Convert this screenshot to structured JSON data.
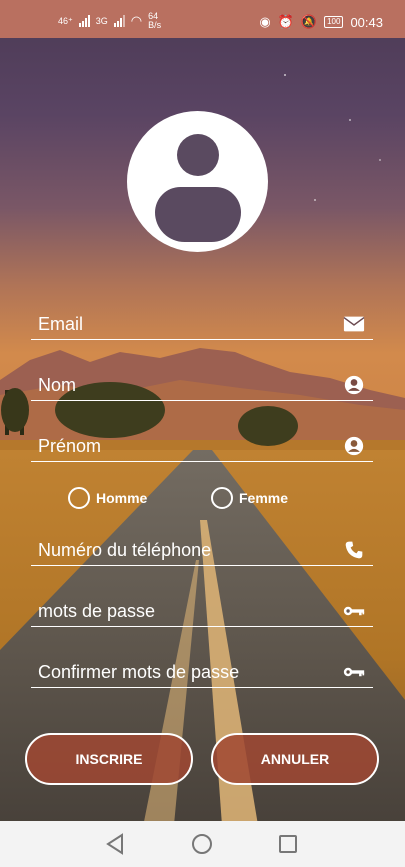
{
  "status_bar": {
    "network_label": "46⁺",
    "network2_label": "3G",
    "speed_label": "64\nB/s",
    "battery_label": "100",
    "time": "00:43"
  },
  "form": {
    "email_label": "Email",
    "nom_label": "Nom",
    "prenom_label": "Prénom",
    "gender_options": [
      "Homme",
      "Femme"
    ],
    "phone_label": "Numéro du téléphone",
    "password_label": "mots de passe",
    "confirm_password_label": "Confirmer mots de passe"
  },
  "buttons": {
    "register_label": "INSCRIRE",
    "cancel_label": "ANNULER"
  },
  "colors": {
    "button_bg": "#a04832",
    "status_bar": "#b97060",
    "accent": "#ffffff"
  }
}
